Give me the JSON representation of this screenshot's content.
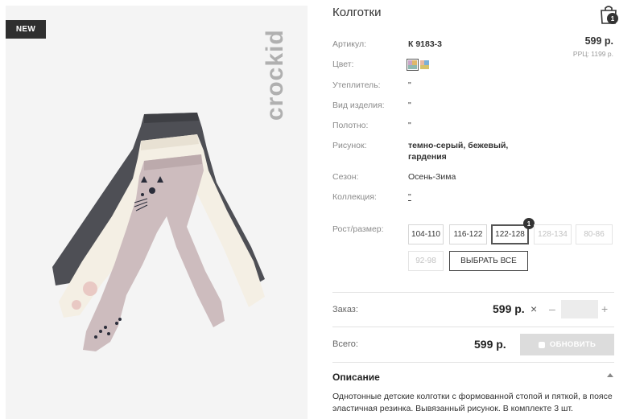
{
  "image_panel": {
    "badge": "NEW",
    "brand_mark": "crockid"
  },
  "product": {
    "title": "Колготки",
    "price": "599 р.",
    "rrp": "РРЦ: 1199 р."
  },
  "cart": {
    "count": "1"
  },
  "attributes": {
    "article_label": "Артикул:",
    "article_value": "К 9183-3",
    "color_label": "Цвет:",
    "insulation_label": "Утеплитель:",
    "insulation_value": "\"",
    "type_label": "Вид изделия:",
    "type_value": "\"",
    "fabric_label": "Полотно:",
    "fabric_value": "\"",
    "pattern_label": "Рисунок:",
    "pattern_line1": "темно-серый, бежевый,",
    "pattern_line2": "гардения",
    "season_label": "Сезон:",
    "season_value": "Осень-Зима",
    "collection_label": "Коллекция:",
    "collection_value": "\""
  },
  "sizes": {
    "label": "Рост/размер:",
    "options": [
      "104-110",
      "116-122",
      "122-128",
      "128-134",
      "80-86",
      "92-98"
    ],
    "selected": "122-128",
    "selected_count": "1",
    "select_all": "ВЫБРАТЬ ВСЕ"
  },
  "order": {
    "label": "Заказ:",
    "price": "599 р.",
    "remove": "×",
    "minus": "–",
    "plus": "+",
    "quantity": ""
  },
  "total": {
    "label": "Всего:",
    "price": "599 р.",
    "update_button": "ОБНОВИТЬ"
  },
  "description": {
    "title": "Описание",
    "text": "Однотонные детские колготки с формованной стопой и пяткой, в поясе эластичная резинка. Вывязанный рисунок. В комплекте 3 шт."
  },
  "colors": {
    "dark_tights": "#4e4f55",
    "cream_tights": "#f4efe4",
    "pink_tights": "#cdbcbe",
    "accent_dark": "#2f2f2f",
    "disabled_button": "#dcdcdc"
  },
  "icons": {
    "cart": "shopping-bag-icon",
    "remove": "close-icon",
    "collapse": "chevron-up-icon"
  }
}
